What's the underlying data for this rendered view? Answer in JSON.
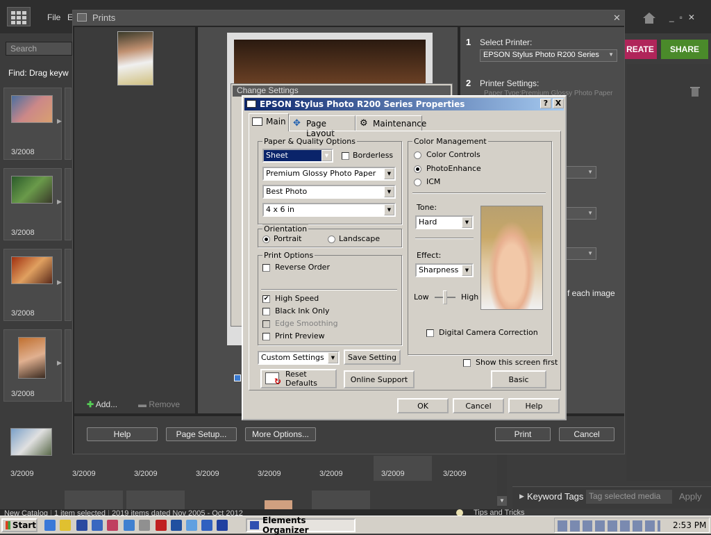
{
  "organizer": {
    "menu": {
      "file": "File",
      "edit_partial": "E"
    },
    "search_placeholder": "Search",
    "find_text": "Find: Drag keyw",
    "left_dates": [
      "3/2008",
      "3/2008",
      "3/2008",
      "3/2008"
    ],
    "bottom_dates": [
      "3/2009",
      "3/2009",
      "3/2009",
      "3/2009",
      "3/2009",
      "3/2009",
      "3/2009",
      "3/2009"
    ],
    "create_label": "REATE",
    "share_label": "SHARE",
    "keyword_tags": "Keyword Tags",
    "tag_placeholder": "Tag selected media",
    "apply_label": "Apply",
    "status": [
      "New Catalog",
      "1 item selected",
      "2019 items dated Nov 2005 - Oct 2012"
    ],
    "tips": "Tips and Tricks",
    "colors": {
      "create": "#b0255a",
      "share": "#4a8a2a"
    }
  },
  "prints": {
    "title": "Prints",
    "add_label": "Add...",
    "remove_label": "Remove",
    "step1_num": "1",
    "step1_label": "Select Printer:",
    "printer": "EPSON Stylus Photo R200 Series",
    "step2_num": "2",
    "step2_label": "Printer Settings:",
    "paper_type": "Paper Type:Premium Glossy Photo Paper",
    "each_image": "f each image",
    "help": "Help",
    "page_setup": "Page Setup...",
    "more_options": "More Options...",
    "print": "Print",
    "cancel": "Cancel"
  },
  "change_settings": {
    "title": "Change Settings"
  },
  "dialog": {
    "title": "EPSON Stylus Photo R200 Series Properties",
    "help_btn": "?",
    "close_btn": "X",
    "tabs": [
      "Main",
      "Page Layout",
      "Maintenance"
    ],
    "paper_quality": {
      "label": "Paper & Quality Options",
      "source": "Sheet",
      "borderless": "Borderless",
      "media": "Premium Glossy Photo Paper",
      "quality": "Best Photo",
      "size": "4 x 6 in"
    },
    "orientation": {
      "label": "Orientation",
      "portrait": "Portrait",
      "landscape": "Landscape"
    },
    "print_options": {
      "label": "Print Options",
      "reverse_order": "Reverse Order",
      "high_speed": "High Speed",
      "black_ink": "Black Ink Only",
      "edge_smoothing": "Edge Smoothing",
      "print_preview": "Print Preview"
    },
    "custom_settings": "Custom Settings",
    "save_setting": "Save Setting",
    "reset_defaults": "Reset Defaults",
    "online_support": "Online Support",
    "color_mgmt": {
      "label": "Color Management",
      "color_controls": "Color Controls",
      "photo_enhance": "PhotoEnhance",
      "icm": "ICM"
    },
    "tone_label": "Tone:",
    "tone": "Hard",
    "effect_label": "Effect:",
    "effect": "Sharpness",
    "low": "Low",
    "high": "High",
    "digital_camera": "Digital Camera Correction",
    "show_screen": "Show this screen first",
    "basic": "Basic",
    "ok": "OK",
    "cancel": "Cancel",
    "help": "Help"
  },
  "taskbar": {
    "start": "Start",
    "task": "Elements Organizer",
    "clock": "2:53 PM"
  }
}
